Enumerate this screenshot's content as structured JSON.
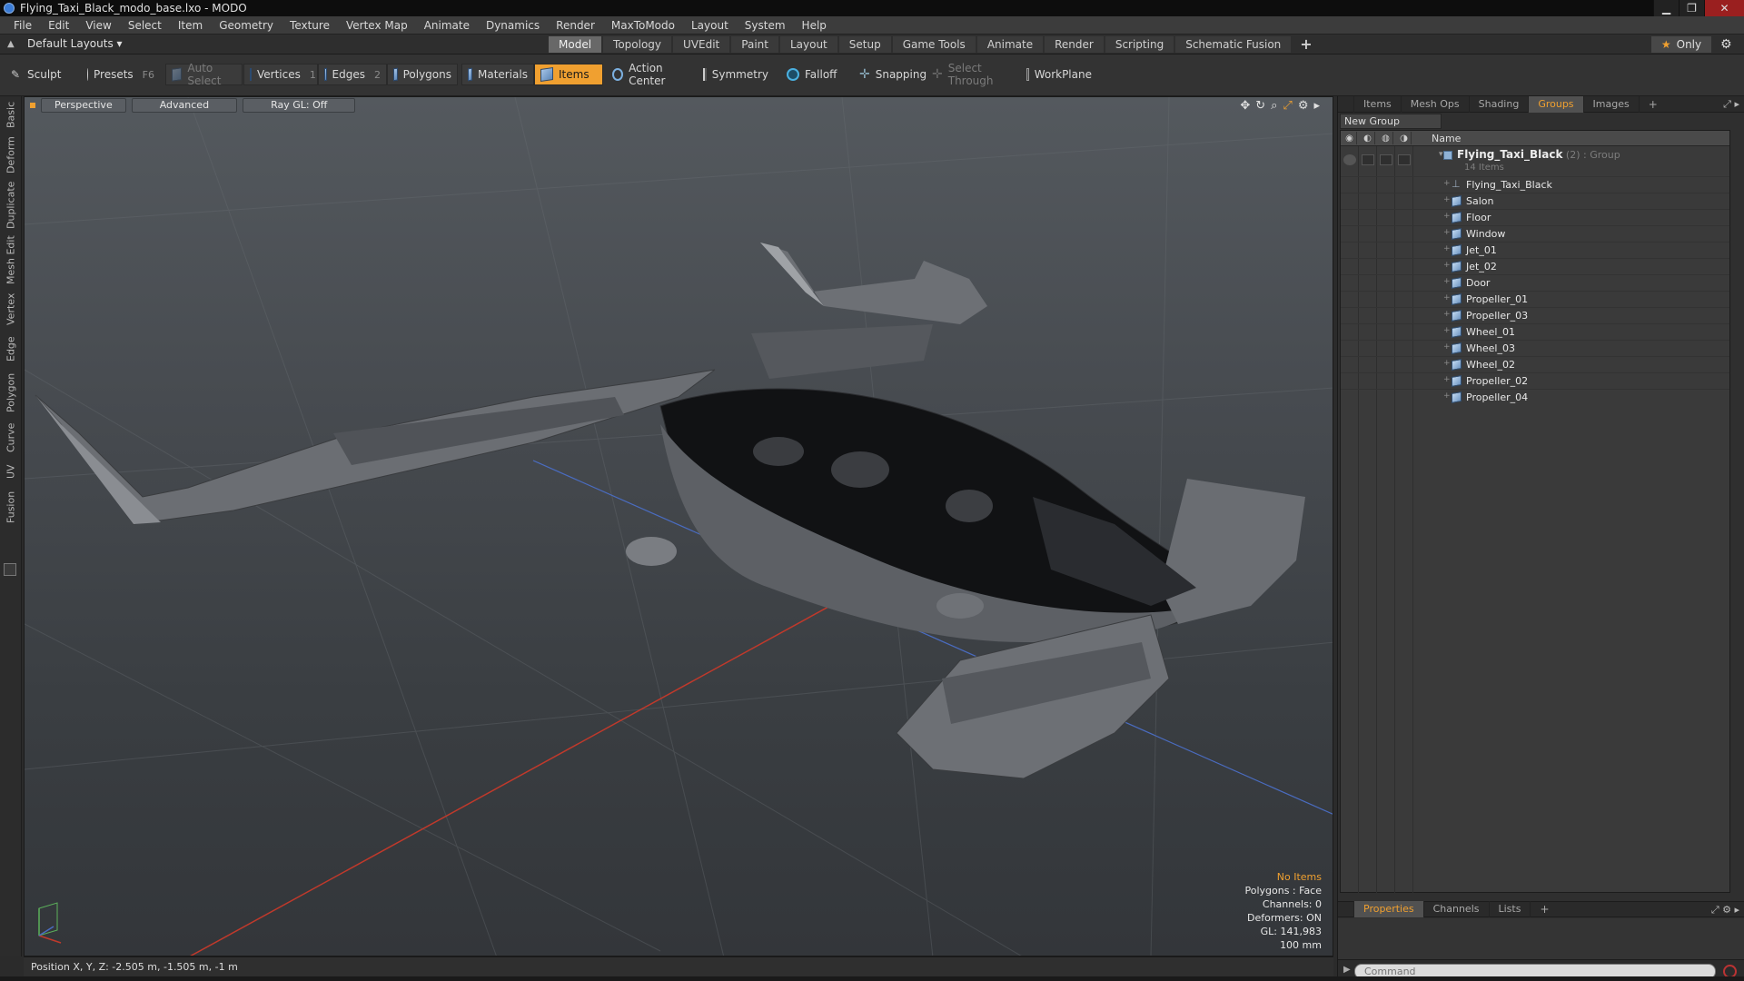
{
  "window": {
    "title": "Flying_Taxi_Black_modo_base.lxo - MODO",
    "min_glyph": "▁",
    "max_glyph": "❐",
    "close_glyph": "✕"
  },
  "menu": [
    "File",
    "Edit",
    "View",
    "Select",
    "Item",
    "Geometry",
    "Texture",
    "Vertex Map",
    "Animate",
    "Dynamics",
    "Render",
    "MaxToModo",
    "Layout",
    "System",
    "Help"
  ],
  "layout_bar": {
    "preset_label": "Default Layouts ▾",
    "tabs": [
      "Model",
      "Topology",
      "UVEdit",
      "Paint",
      "Layout",
      "Setup",
      "Game Tools",
      "Animate",
      "Render",
      "Scripting",
      "Schematic Fusion"
    ],
    "active_tab": "Model",
    "add_tab": "+",
    "only_label": "Only"
  },
  "toolbar": {
    "sculpt": "Sculpt",
    "presets": "Presets",
    "presets_key": "F6",
    "auto_select": "Auto Select",
    "vertices": "Vertices",
    "vertices_key": "1",
    "edges": "Edges",
    "edges_key": "2",
    "polygons": "Polygons",
    "materials": "Materials",
    "items": "Items",
    "action_center": "Action Center",
    "symmetry": "Symmetry",
    "falloff": "Falloff",
    "snapping": "Snapping",
    "select_through": "Select Through",
    "workplane": "WorkPlane"
  },
  "left_tabs": [
    "Basic",
    "Deform",
    "Duplicate",
    "Mesh Edit",
    "Vertex",
    "Edge",
    "Polygon",
    "Curve",
    "UV",
    "Fusion"
  ],
  "viewport": {
    "view_mode": "Perspective",
    "shading": "Advanced",
    "raygl": "Ray GL: Off",
    "stats": {
      "selection": "No Items",
      "polygons": "Polygons : Face",
      "channels": "Channels: 0",
      "deformers": "Deformers: ON",
      "gl": "GL: 141,983",
      "unit": "100 mm"
    }
  },
  "status_bar": {
    "position": "Position X, Y, Z:   -2.505 m, -1.505 m, -1 m"
  },
  "right_panel": {
    "tabs": [
      "Items",
      "Mesh Ops",
      "Shading",
      "Groups",
      "Images"
    ],
    "active_tab": "Groups",
    "add_tab": "+",
    "new_group": "New Group",
    "name_header": "Name",
    "group": {
      "name": "Flying_Taxi_Black",
      "suffix": " (2) : Group",
      "count": "14 Items"
    },
    "items": [
      "Flying_Taxi_Black",
      "Salon",
      "Floor",
      "Window",
      "Jet_01",
      "Jet_02",
      "Door",
      "Propeller_01",
      "Propeller_03",
      "Wheel_01",
      "Wheel_03",
      "Wheel_02",
      "Propeller_02",
      "Propeller_04"
    ],
    "bottom_tabs": [
      "Properties",
      "Channels",
      "Lists"
    ],
    "bottom_active": "Properties",
    "command_placeholder": "Command"
  },
  "colors": {
    "accent": "#f0a030",
    "viewport_top": "#54595e",
    "viewport_bottom": "#33363a"
  }
}
